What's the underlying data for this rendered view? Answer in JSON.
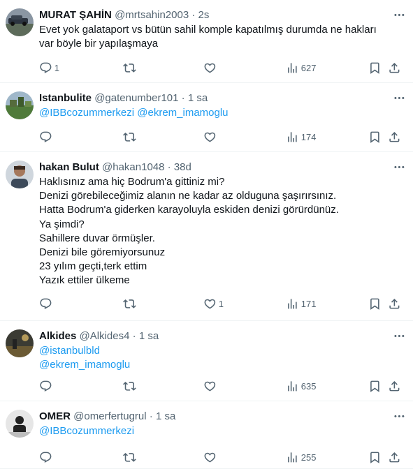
{
  "tweets": [
    {
      "name": "MURAT ŞAHİN",
      "handle": "@mrtsahin2003",
      "time": "2s",
      "lines": [
        "Evet yok galataport vs bütün sahil komple kapatılmış durumda ne hakları",
        "var böyle bir yapılaşmaya"
      ],
      "replies": "1",
      "retweets": "",
      "likes": "",
      "views": "627"
    },
    {
      "name": "Istanbulite",
      "handle": "@gatenumber101",
      "time": "1 sa",
      "lines": [
        "@IBBcozummerkezi @ekrem_imamoglu"
      ],
      "replies": "",
      "retweets": "",
      "likes": "",
      "views": "174"
    },
    {
      "name": "hakan Bulut",
      "handle": "@hakan1048",
      "time": "38d",
      "lines": [
        "Haklısınız ama hiç Bodrum'a gittiniz mi?",
        "Denizi görebileceğimiz alanın ne kadar az olduguna şaşırırsınız.",
        "Hatta Bodrum'a giderken karayoluyla eskiden denizi görürdünüz.",
        "Ya şimdi?",
        "Sahillere duvar örmüşler.",
        "Denizi bile göremiyorsunuz",
        "23 yılım geçti,terk ettim",
        "Yazık ettiler ülkeme"
      ],
      "replies": "",
      "retweets": "",
      "likes": "1",
      "views": "171"
    },
    {
      "name": "Alkides",
      "handle": "@Alkides4",
      "time": "1 sa",
      "lines": [
        "@istanbulbld",
        "@ekrem_imamoglu"
      ],
      "replies": "",
      "retweets": "",
      "likes": "",
      "views": "635"
    },
    {
      "name": "OMER",
      "handle": "@omerfertugrul",
      "time": "1 sa",
      "lines": [
        "@IBBcozummerkezi"
      ],
      "replies": "",
      "retweets": "",
      "likes": "",
      "views": "255"
    }
  ],
  "icons": {
    "reply": "reply-icon",
    "retweet": "retweet-icon",
    "like": "heart-icon",
    "views": "views-icon",
    "bookmark": "bookmark-icon",
    "share": "share-icon",
    "more": "more-icon"
  },
  "colors": {
    "text": "#0f1419",
    "secondary": "#536471",
    "link": "#1d9bf0",
    "divider": "#eff3f4"
  }
}
